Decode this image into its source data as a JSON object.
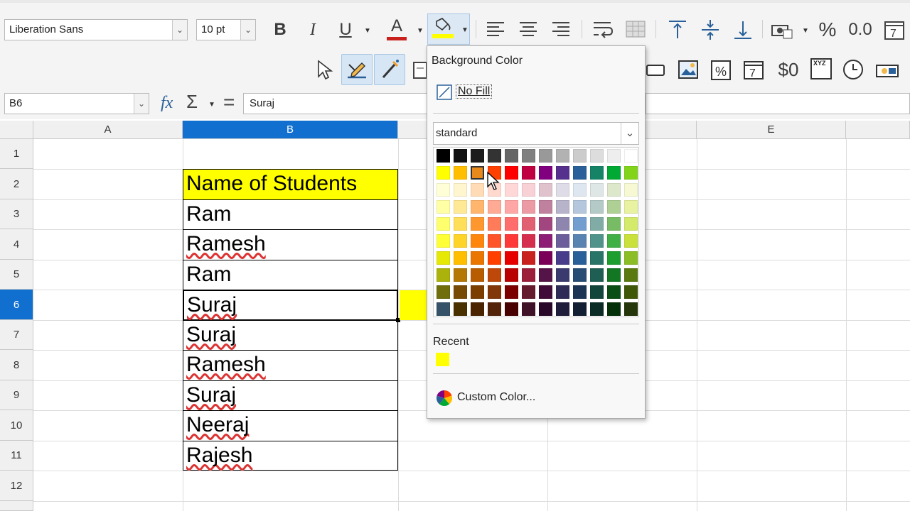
{
  "toolbar": {
    "font_name": "Liberation Sans",
    "font_size": "10 pt",
    "bold": "B",
    "italic": "I",
    "underline": "U",
    "font_color_glyph": "A",
    "percent": "%",
    "decimal": "0.0",
    "currency": "$0",
    "xyz": "XYZ",
    "date_glyph": "7"
  },
  "formula_bar": {
    "cell_ref": "B6",
    "fx": "fx",
    "sum": "Σ",
    "equals": "=",
    "content": "Suraj"
  },
  "columns": [
    "A",
    "B",
    "E"
  ],
  "rows": [
    "1",
    "2",
    "3",
    "4",
    "5",
    "6",
    "7",
    "8",
    "9",
    "10",
    "11",
    "12"
  ],
  "cells": {
    "B2": "Name of Students",
    "B3": "Ram",
    "B4": "Ramesh",
    "B5": "Ram",
    "B6": "Suraj",
    "B7": "Suraj",
    "B8": "Ramesh",
    "B9": "Suraj",
    "B10": "Neeraj",
    "B11": "Rajesh"
  },
  "colors": {
    "header_fill": "#ffff00",
    "selection_blue": "#1170cf",
    "spill_yellow": "#ffff00"
  },
  "popup": {
    "title": "Background Color",
    "no_fill": "No Fill",
    "palette": "standard",
    "recent_label": "Recent",
    "recent_colors": [
      "#ffff00"
    ],
    "custom_color": "Custom Color...",
    "selected_swatch": "#e8891c",
    "palette_rows": [
      [
        "#000000",
        "#111111",
        "#1c1c1c",
        "#333333",
        "#666666",
        "#808080",
        "#999999",
        "#b2b2b2",
        "#cccccc",
        "#dddddd",
        "#eeeeee",
        "#ffffff"
      ],
      [
        "#ffff00",
        "#ffbf00",
        "#e8891c",
        "#ff4000",
        "#ff0000",
        "#bf0041",
        "#800080",
        "#55308d",
        "#2a6099",
        "#158466",
        "#00a933",
        "#81d41a"
      ],
      [
        "#ffffd7",
        "#fff5ce",
        "#ffdbb6",
        "#ffd8ce",
        "#ffd7d7",
        "#f7d1d5",
        "#e0c2cd",
        "#dedce6",
        "#dee6ef",
        "#dee7e5",
        "#dde8cb",
        "#f6f9d4"
      ],
      [
        "#ffffa6",
        "#ffe994",
        "#ffb66c",
        "#ffaa95",
        "#ffa6a6",
        "#ec9ba4",
        "#bf819e",
        "#b7b3ca",
        "#b4c7dc",
        "#b3cac7",
        "#afd095",
        "#e8f2a1"
      ],
      [
        "#ffff6d",
        "#ffde59",
        "#ff972f",
        "#ff7b59",
        "#ff6d6d",
        "#e16173",
        "#a1467e",
        "#8e86ae",
        "#729fcf",
        "#81aca6",
        "#77bc65",
        "#d4ea6b"
      ],
      [
        "#ffff38",
        "#ffd428",
        "#ff860d",
        "#ff5429",
        "#ff3838",
        "#d62e4e",
        "#8d1d75",
        "#6b5e9b",
        "#5983b0",
        "#50938a",
        "#3faf46",
        "#c9e13a"
      ],
      [
        "#e6e905",
        "#ffbf00",
        "#ea7500",
        "#ff4000",
        "#e60000",
        "#c9211e",
        "#7b0058",
        "#483d8b",
        "#2a6099",
        "#287466",
        "#1e9e2e",
        "#8bbd27"
      ],
      [
        "#acb20c",
        "#b47804",
        "#b85c00",
        "#be480a",
        "#b80000",
        "#9c1e3b",
        "#551447",
        "#3b3a6f",
        "#284d75",
        "#1f5f53",
        "#127622",
        "#5a7a10"
      ],
      [
        "#706e0c",
        "#784b04",
        "#7b3d00",
        "#813709",
        "#7b0000",
        "#651a2e",
        "#400b38",
        "#2e2b56",
        "#1c3555",
        "#13463b",
        "#0a4d15",
        "#3f5808"
      ],
      [
        "#355269",
        "#4a3100",
        "#4a2400",
        "#53240a",
        "#490000",
        "#3f1227",
        "#29082a",
        "#1f1d3b",
        "#131f33",
        "#0b2c24",
        "#053109",
        "#24360a"
      ]
    ]
  }
}
